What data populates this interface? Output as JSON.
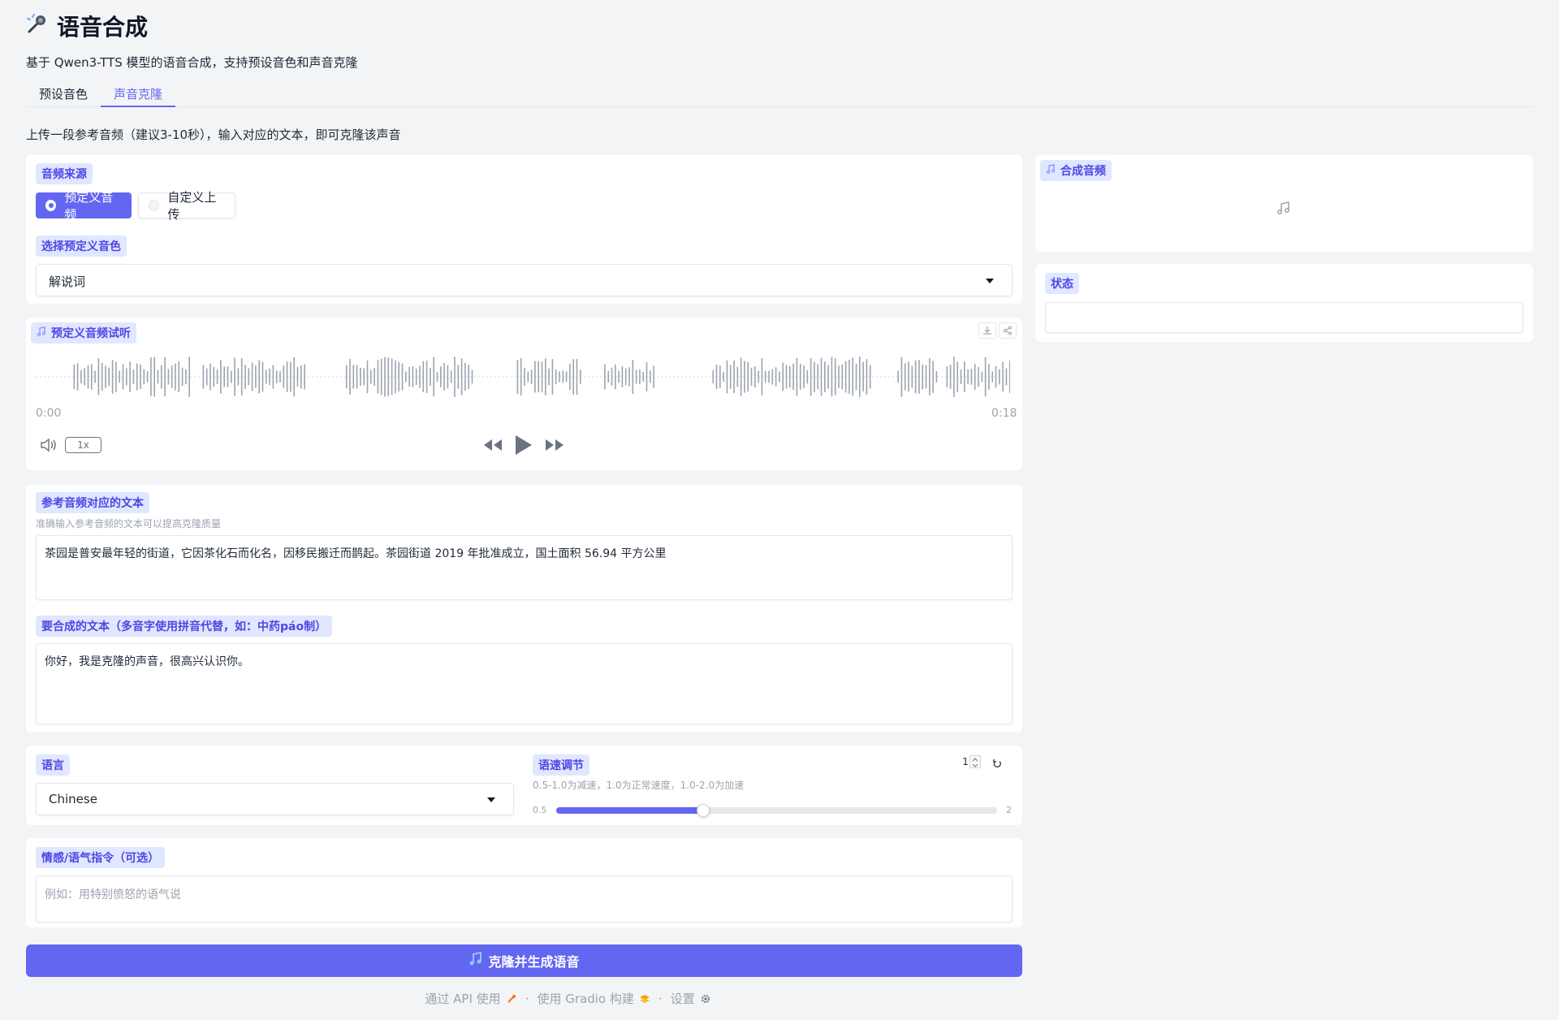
{
  "app": {
    "title": "语音合成",
    "subtitle": "基于 Qwen3-TTS 模型的语音合成，支持预设音色和声音克隆"
  },
  "tabs": [
    {
      "label": "预设音色",
      "active": false
    },
    {
      "label": "声音克隆",
      "active": true
    }
  ],
  "clone": {
    "description": "上传一段参考音频（建议3-10秒），输入对应的文本，即可克隆该声音",
    "audio_source": {
      "label": "音频来源",
      "options": [
        {
          "label": "预定义音频",
          "selected": true
        },
        {
          "label": "自定义上传",
          "selected": false
        }
      ]
    },
    "predefined_voice": {
      "label": "选择预定义音色",
      "value": "解说词"
    },
    "preview": {
      "label": "预定义音频试听",
      "time_start": "0:00",
      "time_end": "0:18",
      "speed": "1x"
    },
    "ref_text": {
      "label": "参考音频对应的文本",
      "info": "准确输入参考音频的文本可以提高克隆质量",
      "value": "茶园是普安最年轻的街道，它因茶化石而化名，因移民搬迁而鹊起。茶园街道 2019 年批准成立，国土面积 56.94 平方公里"
    },
    "target_text": {
      "label": "要合成的文本（多音字使用拼音代替，如：中药páo制）",
      "value": "你好，我是克隆的声音，很高兴认识你。"
    },
    "language": {
      "label": "语言",
      "value": "Chinese"
    },
    "speed": {
      "label": "语速调节",
      "info": "0.5-1.0为减速，1.0为正常速度，1.0-2.0为加速",
      "value": "1",
      "min": "0.5",
      "max": "2",
      "level": 1.0,
      "range": [
        0.5,
        2.0
      ]
    },
    "instruction": {
      "label": "情感/语气指令（可选）",
      "placeholder": "例如：用特别愤怒的语气说"
    },
    "submit_label": "克隆并生成语音"
  },
  "output": {
    "audio_label": "合成音频",
    "status_label": "状态",
    "status_value": ""
  },
  "footer": {
    "api": "通过 API 使用",
    "gradio": "使用 Gradio 构建",
    "settings": "设置",
    "sep": "·"
  },
  "colors": {
    "accent": "#6366f1",
    "label_bg": "#e0e7ff",
    "label_text": "#4f46e5"
  }
}
